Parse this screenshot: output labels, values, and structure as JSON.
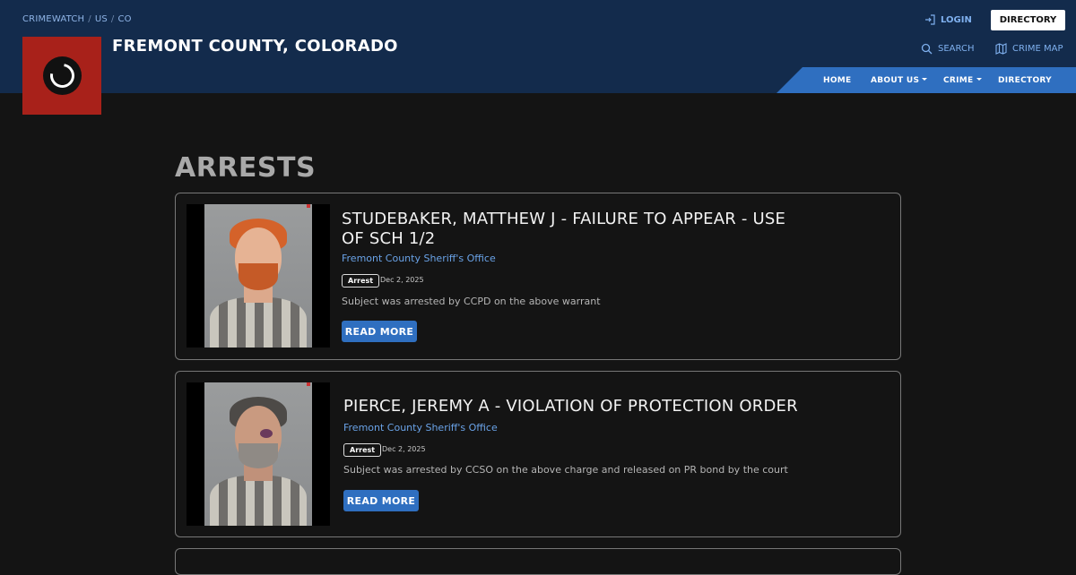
{
  "breadcrumb": [
    "CRIMEWATCH",
    "US",
    "CO"
  ],
  "site": {
    "title": "FREMONT COUNTY, COLORADO"
  },
  "top_links": {
    "login": "LOGIN",
    "directory_button": "DIRECTORY",
    "search": "SEARCH",
    "crime_map": "CRIME MAP"
  },
  "nav": [
    {
      "label": "HOME",
      "has_dropdown": false
    },
    {
      "label": "ABOUT US",
      "has_dropdown": true
    },
    {
      "label": "CRIME",
      "has_dropdown": true
    },
    {
      "label": "DIRECTORY",
      "has_dropdown": false
    }
  ],
  "page": {
    "title": "ARRESTS"
  },
  "arrests": [
    {
      "title": "STUDEBAKER, MATTHEW J - FAILURE TO APPEAR - USE OF SCH 1/2",
      "agency": "Fremont County Sheriff's Office",
      "badge": "Arrest",
      "date": "Dec 2, 2025",
      "description": "Subject was arrested by CCPD on the above warrant",
      "button": "READ MORE"
    },
    {
      "title": "PIERCE, JEREMY A - VIOLATION OF PROTECTION ORDER",
      "agency": "Fremont County Sheriff's Office",
      "badge": "Arrest",
      "date": "Dec 2, 2025",
      "description": "Subject was arrested by CCSO on the above charge and released on PR bond by the court",
      "button": "READ MORE"
    }
  ],
  "colors": {
    "header_bg": "#132b4c",
    "nav_bg": "#2f6fc0",
    "logo_bg": "#a8211a",
    "link": "#6aa3e8",
    "page_bg": "#141414"
  }
}
